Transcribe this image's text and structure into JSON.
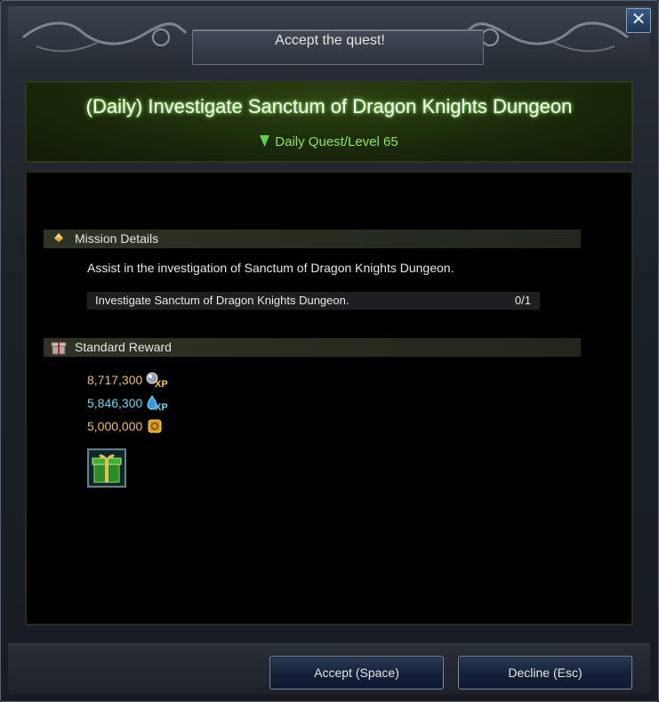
{
  "window": {
    "title": "Accept the quest!",
    "close_label": "✕"
  },
  "quest": {
    "title": "(Daily) Investigate Sanctum of Dragon Knights Dungeon",
    "subtitle": "Daily Quest/Level 65"
  },
  "mission": {
    "header": "Mission Details",
    "description": "Assist in the investigation of Sanctum of Dragon Knights Dungeon.",
    "objective": "Investigate Sanctum of Dragon Knights Dungeon.",
    "objective_progress": "0/1"
  },
  "reward": {
    "header": "Standard Reward",
    "items": [
      {
        "value": "8,717,300",
        "icon": "xp-orb-icon",
        "icon_text": "XP",
        "color": "#e8c06a"
      },
      {
        "value": "5,846,300",
        "icon": "water-drop-xp-icon",
        "icon_text": "XP",
        "color": "#6ad9ef"
      },
      {
        "value": "5,000,000",
        "icon": "gold-coin-icon",
        "color": "#e8c06a"
      }
    ],
    "item_slot_icon": "green-gift-box-icon"
  },
  "buttons": {
    "accept": "Accept (Space)",
    "decline": "Decline (Esc)"
  }
}
